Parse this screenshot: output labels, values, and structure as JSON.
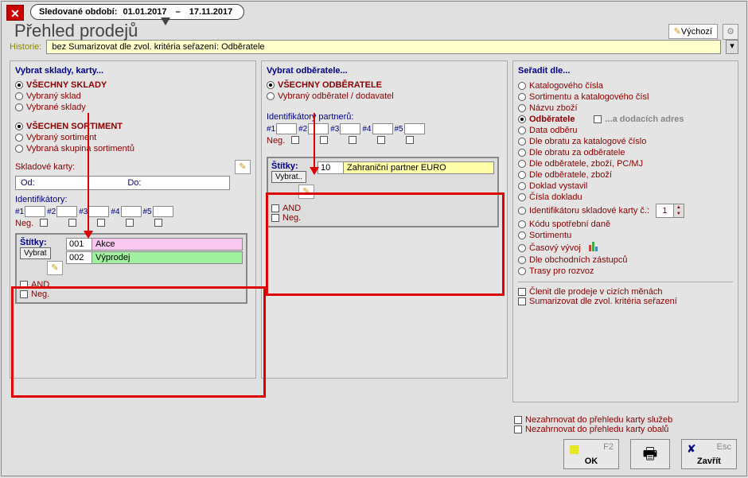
{
  "header": {
    "date_label": "Sledované období:",
    "date_from": "01.01.2017",
    "date_sep": "–",
    "date_to": "17.11.2017",
    "title": "Přehled prodejů",
    "default_btn": "Výchozí"
  },
  "history": {
    "label": "Historie:",
    "value": "bez Sumarizovat dle zvol. kritéria seřazení: Odběratele"
  },
  "panel1": {
    "title": "Vybrat sklady, karty...",
    "g1": [
      {
        "label": "VŠECHNY SKLADY",
        "sel": true
      },
      {
        "label": "Vybraný sklad",
        "sel": false
      },
      {
        "label": "Vybrané sklady",
        "sel": false
      }
    ],
    "g2": [
      {
        "label": "VŠECHEN SORTIMENT",
        "sel": true
      },
      {
        "label": "Vybraný sortiment",
        "sel": false
      },
      {
        "label": "Vybraná skupina sortimentů",
        "sel": false
      }
    ],
    "sklad_label": "Skladové karty:",
    "od": "Od:",
    "do": "Do:",
    "ident_label": "Identifikátory:",
    "ids": [
      "#1",
      "#2",
      "#3",
      "#4",
      "#5"
    ],
    "neg": "Neg.",
    "stitky_label": "Štítky:",
    "vybrat": "Vybrat",
    "and": "AND",
    "tags": [
      {
        "code": "001",
        "name": "Akce"
      },
      {
        "code": "002",
        "name": "Výprodej"
      }
    ]
  },
  "panel2": {
    "title": "Vybrat odběratele...",
    "g1": [
      {
        "label": "VŠECHNY ODBĚRATELE",
        "sel": true
      },
      {
        "label": "Vybraný odběratel / dodavatel",
        "sel": false
      }
    ],
    "ident_label": "Identifikátory partnerů:",
    "ids": [
      "#1",
      "#2",
      "#3",
      "#4",
      "#5"
    ],
    "neg": "Neg.",
    "stitky_label": "Štítky:",
    "vybrat": "Vybrat..",
    "and": "AND",
    "tags": [
      {
        "code": "10",
        "name": "Zahraniční partner EURO"
      }
    ]
  },
  "panel3": {
    "title": "Seřadit dle...",
    "opts": [
      "Katalogového čísla",
      "Sortimentu a katalogového čísl",
      "Názvu zboží",
      "Odběratele",
      "Data odběru",
      "Dle obratu za katalogové číslo",
      "Dle obratu za odběratele",
      "Dle odběratele, zboží, PC/MJ",
      "Dle odběratele, zboží",
      "Doklad vystavil",
      "Čísla dokladu",
      "Identifikátoru skladové karty č.:",
      "Kódu spotřební daně",
      "Sortimentu",
      "Časový vývoj",
      "Dle obchodních zástupců",
      "Trasy pro rozvoz"
    ],
    "sel_idx": 3,
    "dodacich": "...a dodacích adres",
    "spin_val": "1",
    "checks1": [
      "Členit dle prodeje v cizích měnách",
      "Sumarizovat dle zvol. kritéria seřazení"
    ],
    "checks2": [
      "Nezahrnovat do přehledu karty služeb",
      "Nezahrnovat do přehledu karty obalů"
    ]
  },
  "buttons": {
    "ok_key": "F2",
    "ok": "OK",
    "close_key": "Esc",
    "close": "Zavřít"
  }
}
